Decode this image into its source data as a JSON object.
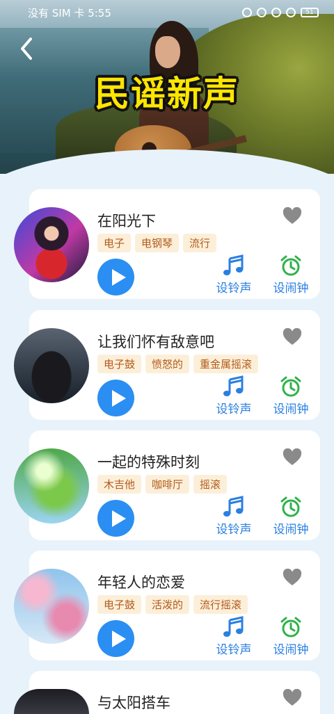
{
  "status_bar": {
    "carrier_time": "没有 SIM 卡 5:55",
    "battery": "51"
  },
  "header": {
    "title": "民谣新声"
  },
  "songs": [
    {
      "title": "在阳光下",
      "tags": [
        "电子",
        "电钢琴",
        "流行"
      ],
      "ring_label": "设铃声",
      "alarm_label": "设闹钟"
    },
    {
      "title": "让我们怀有敌意吧",
      "tags": [
        "电子鼓",
        "愤怒的",
        "重金属摇滚"
      ],
      "ring_label": "设铃声",
      "alarm_label": "设闹钟"
    },
    {
      "title": "一起的特殊时刻",
      "tags": [
        "木吉他",
        "咖啡厅",
        "摇滚"
      ],
      "ring_label": "设铃声",
      "alarm_label": "设闹钟"
    },
    {
      "title": "年轻人的恋爱",
      "tags": [
        "电子鼓",
        "活泼的",
        "流行摇滚"
      ],
      "ring_label": "设铃声",
      "alarm_label": "设闹钟"
    },
    {
      "title": "与太阳搭车",
      "tags": [],
      "ring_label": "",
      "alarm_label": ""
    }
  ],
  "colors": {
    "accent": "#2b8ef2",
    "tag_bg": "#fcefd9",
    "tag_text": "#b25a1b",
    "alarm_green": "#2fb24a",
    "title_yellow": "#ffe600"
  }
}
